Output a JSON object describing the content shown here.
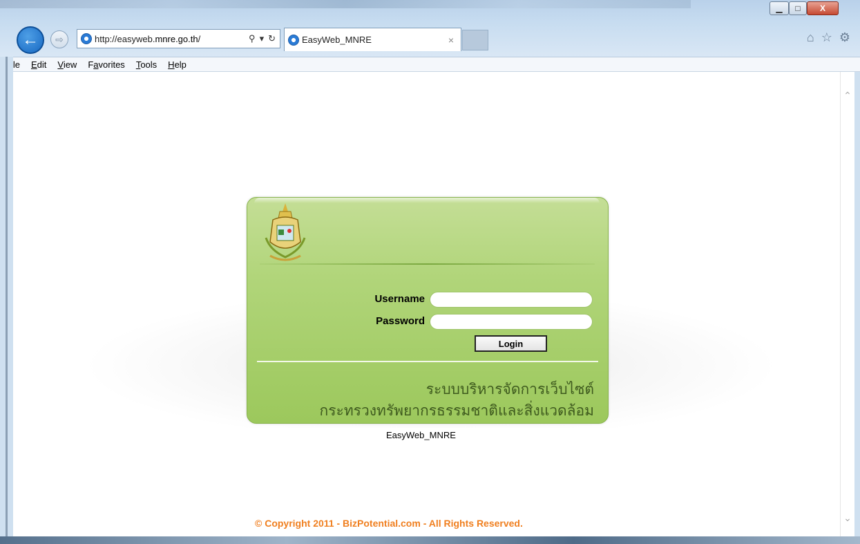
{
  "browser": {
    "address_url": "http://easyweb.mnre.go.th/",
    "address_url_prefix": "http://easyweb.",
    "address_url_domain": "mnre.go.th",
    "address_url_suffix": "/",
    "search_icon": "search-icon",
    "refresh_icon": "refresh-icon",
    "tab_title": "EasyWeb_MNRE",
    "tab_close": "×",
    "window_controls": {
      "minimize": "▁",
      "maximize": "□",
      "close": "X"
    },
    "menu": [
      "File",
      "Edit",
      "View",
      "Favorites",
      "Tools",
      "Help"
    ],
    "menu_underline": [
      "F",
      "E",
      "V",
      "a",
      "T",
      "H"
    ],
    "toolbar_icons": [
      "home-icon",
      "star-icon",
      "gear-icon"
    ]
  },
  "login": {
    "username_label": "Username",
    "password_label": "Password",
    "username_value": "",
    "password_value": "",
    "login_button": "Login",
    "thai_line1": "ระบบบริหารจัดการเว็บไซต์",
    "thai_line2": "กระทรวงทรัพยากรธรรมชาติและสิ่งแวดล้อม",
    "site_name": "EasyWeb_MNRE"
  },
  "footer": {
    "copyright": "© Copyright 2011 - BizPotential.com - All Rights Reserved."
  },
  "colors": {
    "panel_green": "#b1d57a",
    "copyright_orange": "#f07f1f",
    "back_button_blue": "#1768c2"
  }
}
